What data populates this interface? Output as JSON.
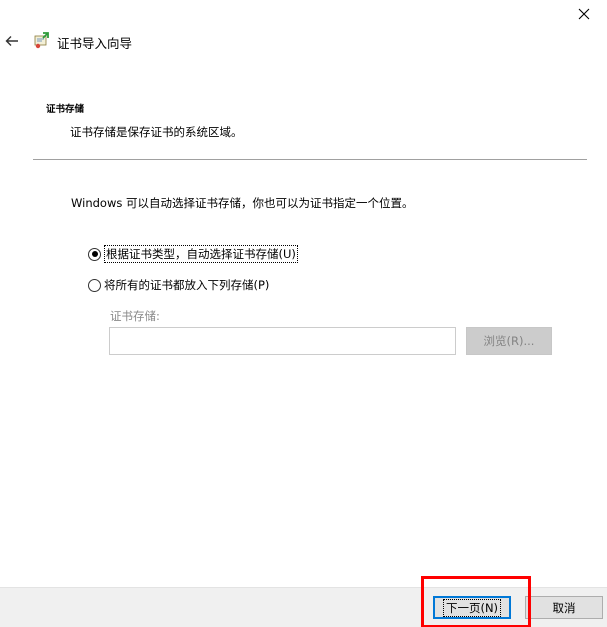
{
  "window": {
    "title": "证书导入向导",
    "close_glyph": "✕",
    "back_glyph": "←"
  },
  "section": {
    "title": "证书存储",
    "description": "证书存储是保存证书的系统区域。"
  },
  "intro_text": "Windows 可以自动选择证书存储，你也可以为证书指定一个位置。",
  "options": [
    {
      "label": "根据证书类型，自动选择证书存储(U)",
      "selected": true
    },
    {
      "label": "将所有的证书都放入下列存储(P)",
      "selected": false
    }
  ],
  "store": {
    "label": "证书存储:",
    "value": "",
    "browse_label": "浏览(R)..."
  },
  "footer": {
    "next_label": "下一页(N)",
    "cancel_label": "取消"
  },
  "colors": {
    "accent": "#0078d7",
    "highlight": "#ff0000",
    "footer_bg": "#f0f0f0"
  }
}
